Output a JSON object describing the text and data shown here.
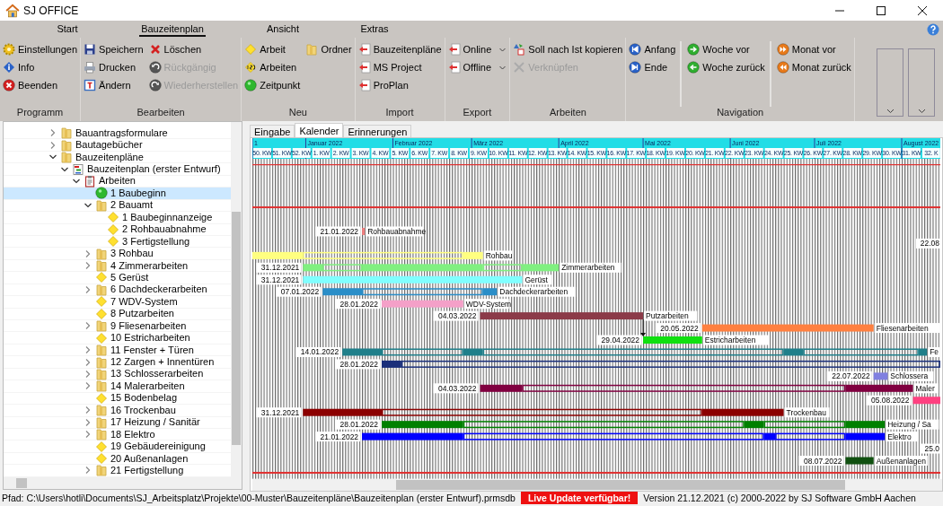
{
  "window": {
    "title": "SJ OFFICE"
  },
  "ribbon": {
    "tabs": [
      {
        "label": "Start",
        "selected": false
      },
      {
        "label": "Bauzeitenplan",
        "selected": true
      },
      {
        "label": "Ansicht",
        "selected": false
      },
      {
        "label": "Extras",
        "selected": false
      }
    ],
    "groups": [
      {
        "label": "Programm",
        "columns": [
          [
            {
              "label": "Einstellungen",
              "kind": "button",
              "disabled": false
            },
            {
              "label": "Info",
              "kind": "button",
              "disabled": false
            },
            {
              "label": "Beenden",
              "kind": "button",
              "disabled": false
            }
          ]
        ]
      },
      {
        "label": "Bearbeiten",
        "columns": [
          [
            {
              "label": "Speichern",
              "kind": "button",
              "disabled": false
            },
            {
              "label": "Drucken",
              "kind": "button",
              "disabled": false
            },
            {
              "label": "Ändern",
              "kind": "button",
              "disabled": false
            }
          ],
          [
            {
              "label": "Löschen",
              "kind": "button",
              "disabled": false
            },
            {
              "label": "Rückgängig",
              "kind": "button",
              "disabled": true
            },
            {
              "label": "Wiederherstellen",
              "kind": "button",
              "disabled": true
            }
          ]
        ]
      },
      {
        "label": "Neu",
        "columns": [
          [
            {
              "label": "Arbeit",
              "kind": "button",
              "disabled": false
            },
            {
              "label": "Arbeiten",
              "kind": "button",
              "disabled": false
            },
            {
              "label": "Zeitpunkt",
              "kind": "button",
              "disabled": false
            }
          ],
          [
            {
              "label": "Ordner",
              "kind": "button",
              "disabled": false
            }
          ]
        ]
      },
      {
        "label": "Import",
        "columns": [
          [
            {
              "label": "Bauzeitenpläne",
              "kind": "button",
              "disabled": false
            },
            {
              "label": "MS Project",
              "kind": "button",
              "disabled": false
            },
            {
              "label": "ProPlan",
              "kind": "button",
              "disabled": false
            }
          ]
        ]
      },
      {
        "label": "Export",
        "columns": [
          [
            {
              "label": "Online",
              "kind": "dropdown",
              "disabled": false
            },
            {
              "label": "Offline",
              "kind": "dropdown",
              "disabled": false
            }
          ]
        ]
      },
      {
        "label": "Arbeiten",
        "columns": [
          [
            {
              "label": "Soll nach Ist kopieren",
              "kind": "button",
              "disabled": false
            },
            {
              "label": "Verknüpfen",
              "kind": "button",
              "disabled": true
            }
          ]
        ]
      },
      {
        "label": "Navigation",
        "columns": [
          [
            {
              "label": "Anfang",
              "kind": "button",
              "disabled": false
            },
            {
              "label": "Ende",
              "kind": "button",
              "disabled": false
            }
          ],
          [
            {
              "label": "Woche vor",
              "kind": "button",
              "disabled": false
            },
            {
              "label": "Woche zurück",
              "kind": "button",
              "disabled": false
            }
          ],
          [
            {
              "label": "Monat vor",
              "kind": "button",
              "disabled": false
            },
            {
              "label": "Monat zurück",
              "kind": "button",
              "disabled": false
            }
          ]
        ]
      }
    ]
  },
  "tree": [
    {
      "label": "Bauantragsformulare",
      "kind": "folder",
      "expanded": false,
      "selected": false
    },
    {
      "label": "Bautagebücher",
      "kind": "folder",
      "expanded": false,
      "selected": false
    },
    {
      "label": "Bauzeitenpläne",
      "kind": "folder",
      "expanded": true,
      "selected": false,
      "children": [
        {
          "label": "Bauzeitenplan (erster Entwurf)",
          "kind": "plan",
          "expanded": true,
          "selected": false,
          "children": [
            {
              "label": "Arbeiten",
              "kind": "list",
              "expanded": true,
              "selected": false,
              "children": [
                {
                  "label": "1 Baubeginn",
                  "kind": "milestone",
                  "selected": true
                },
                {
                  "label": "2 Bauamt",
                  "kind": "folder",
                  "expanded": true,
                  "selected": false,
                  "children": [
                    {
                      "label": "1 Baubeginnanzeige",
                      "kind": "task",
                      "selected": false
                    },
                    {
                      "label": "2 Rohbauabnahme",
                      "kind": "task",
                      "selected": false
                    },
                    {
                      "label": "3 Fertigstellung",
                      "kind": "task",
                      "selected": false
                    }
                  ]
                },
                {
                  "label": "3 Rohbau",
                  "kind": "folder",
                  "expanded": false,
                  "selected": false
                },
                {
                  "label": "4 Zimmerarbeiten",
                  "kind": "folder",
                  "expanded": false,
                  "selected": false
                },
                {
                  "label": "5 Gerüst",
                  "kind": "task",
                  "selected": false
                },
                {
                  "label": "6 Dachdeckerarbeiten",
                  "kind": "folder",
                  "expanded": false,
                  "selected": false
                },
                {
                  "label": "7 WDV-System",
                  "kind": "task",
                  "selected": false
                },
                {
                  "label": "8 Putzarbeiten",
                  "kind": "task",
                  "selected": false
                },
                {
                  "label": "9 Fliesenarbeiten",
                  "kind": "folder",
                  "expanded": false,
                  "selected": false
                },
                {
                  "label": "10 Estricharbeiten",
                  "kind": "task",
                  "selected": false
                },
                {
                  "label": "11 Fenster + Türen",
                  "kind": "folder",
                  "expanded": false,
                  "selected": false
                },
                {
                  "label": "12 Zargen + Innentüren",
                  "kind": "folder",
                  "expanded": false,
                  "selected": false
                },
                {
                  "label": "13 Schlosserarbeiten",
                  "kind": "folder",
                  "expanded": false,
                  "selected": false
                },
                {
                  "label": "14 Malerarbeiten",
                  "kind": "folder",
                  "expanded": false,
                  "selected": false
                },
                {
                  "label": "15 Bodenbelag",
                  "kind": "task",
                  "selected": false
                },
                {
                  "label": "16 Trockenbau",
                  "kind": "folder",
                  "expanded": false,
                  "selected": false
                },
                {
                  "label": "17 Heizung / Sanitär",
                  "kind": "folder",
                  "expanded": false,
                  "selected": false
                },
                {
                  "label": "18 Elektro",
                  "kind": "folder",
                  "expanded": false,
                  "selected": false
                },
                {
                  "label": "19 Gebäudereinigung",
                  "kind": "task",
                  "selected": false
                },
                {
                  "label": "20 Außenanlagen",
                  "kind": "task",
                  "selected": false
                },
                {
                  "label": "21 Fertigstellung",
                  "kind": "folder",
                  "expanded": false,
                  "selected": false
                }
              ]
            }
          ]
        }
      ]
    }
  ],
  "view_tabs": [
    {
      "label": "Eingabe",
      "selected": false
    },
    {
      "label": "Kalender",
      "selected": true
    },
    {
      "label": "Erinnerungen",
      "selected": false
    }
  ],
  "gantt": {
    "months": [
      "1",
      "Januar 2022",
      "Februar 2022",
      "März 2022",
      "April 2022",
      "Mai 2022",
      "Juni 2022",
      "Juli 2022",
      "August 2022"
    ],
    "weeks": [
      "50. KW",
      "51. KW",
      "52. KW",
      "1. KW",
      "2. KW",
      "3. KW",
      "4. KW",
      "5. KW",
      "6. KW",
      "7. KW",
      "8. KW",
      "9. KW",
      "10. KW",
      "11. KW",
      "12. KW",
      "13. KW",
      "14. KW",
      "15. KW",
      "16. KW",
      "17. KW",
      "18. KW",
      "19. KW",
      "20. KW",
      "21. KW",
      "22. KW",
      "23. KW",
      "24. KW",
      "25. KW",
      "26. KW",
      "27. KW",
      "28. KW",
      "29. KW",
      "30. KW",
      "31. KW",
      "32. K"
    ],
    "rows": [
      {
        "kind": "empty"
      },
      {
        "kind": "empty"
      },
      {
        "kind": "empty"
      },
      {
        "kind": "summary",
        "color": "#e03030"
      },
      {
        "kind": "empty"
      },
      {
        "kind": "bar",
        "date": "21.01.2022",
        "color": "#f08080",
        "name": "Rohbauabnahme"
      },
      {
        "kind": "offscreen",
        "date": "22.08"
      },
      {
        "kind": "bar",
        "color": "#ffff80",
        "name": "Rohbau"
      },
      {
        "kind": "bar",
        "date": "31.12.2021",
        "color": "#80f080",
        "name": "Zimmerarbeiten"
      },
      {
        "kind": "bar",
        "date": "31.12.2021",
        "color": "#80ffff",
        "name": "Gerüst"
      },
      {
        "kind": "bar",
        "date": "07.01.2022",
        "color": "#2a8ec8",
        "name": "Dachdeckerarbeiten"
      },
      {
        "kind": "bar",
        "date": "28.01.2022",
        "color": "#f4a0c8",
        "name": "WDV-System"
      },
      {
        "kind": "bar",
        "date": "04.03.2022",
        "color": "#8b3a48",
        "name": "Putzarbeiten",
        "linked": true
      },
      {
        "kind": "bar",
        "date": "20.05.2022",
        "color": "#ff8040",
        "name": "Fliesenarbeiten"
      },
      {
        "kind": "bar",
        "date": "29.04.2022",
        "color": "#10e010",
        "name": "Estricharbeiten"
      },
      {
        "kind": "bar",
        "date": "14.01.2022",
        "color": "#1f7f8a",
        "name": "Fe"
      },
      {
        "kind": "bar",
        "date": "28.01.2022",
        "color": "#1a2f7a"
      },
      {
        "kind": "bar",
        "date": "22.07.2022",
        "color": "#8080e0",
        "name": "Schlossera"
      },
      {
        "kind": "bar",
        "date": "04.03.2022",
        "color": "#800040",
        "name": "Maler"
      },
      {
        "kind": "bar",
        "date": "05.08.2022",
        "color": "#ff4080"
      },
      {
        "kind": "bar",
        "date": "31.12.2021",
        "color": "#8b0000",
        "name": "Trockenbau"
      },
      {
        "kind": "bar",
        "date": "28.01.2022",
        "color": "#008000",
        "name": "Heizung / Sa"
      },
      {
        "kind": "bar",
        "date": "21.01.2022",
        "color": "#0000ff",
        "name": "Elektro"
      },
      {
        "kind": "offscreen",
        "date": "25.0"
      },
      {
        "kind": "bar",
        "date": "08.07.2022",
        "color": "#105010",
        "name": "Außenanlagen"
      },
      {
        "kind": "summary",
        "color": "#e03030"
      }
    ]
  },
  "status_bar": {
    "path": "Pfad: C:\\Users\\hotli\\Documents\\SJ_Arbeitsplatz\\Projekte\\00-Muster\\Bauzeitenpläne\\Bauzeitenplan (erster Entwurf).prmsdb",
    "alert": "Live Update verfügbar!",
    "version": "Version 21.12.2021  (c) 2000-2022 by SJ Software GmbH Aachen"
  }
}
